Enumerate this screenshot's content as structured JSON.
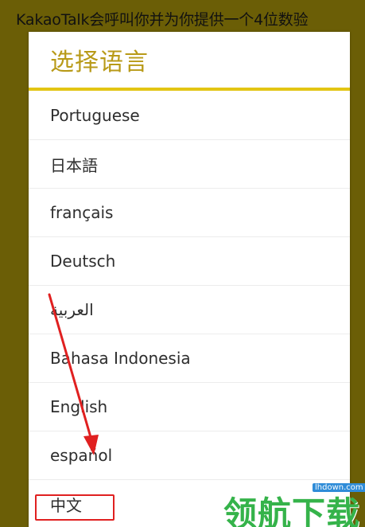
{
  "background": {
    "text": "KakaoTalk会呼叫你并为你提供一个4位数验"
  },
  "dialog": {
    "title": "选择语言",
    "accent_color": "#e3c513",
    "languages": [
      "Portuguese",
      "日本語",
      "français",
      "Deutsch",
      "العربية",
      "Bahasa Indonesia",
      "English",
      "español",
      "中文"
    ]
  },
  "annotation": {
    "highlight_color": "#e02020",
    "highlighted_item": "中文"
  },
  "watermark": {
    "logo_text": "领航下载",
    "site": "lhdown.com"
  }
}
